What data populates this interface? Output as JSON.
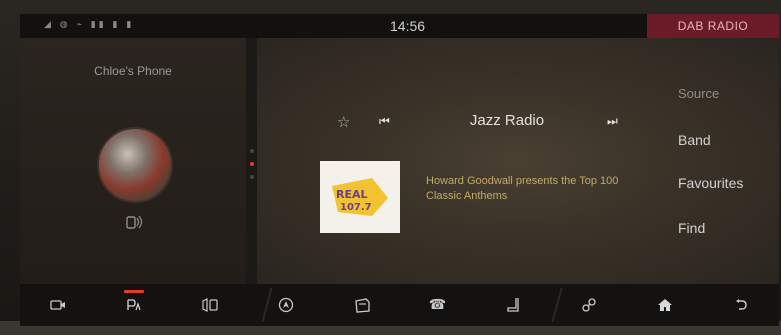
{
  "status_bar": {
    "indicators": "◢ ◍ ⌁ ▮▮ ▮ ▮",
    "time": "14:56",
    "active_tab": "DAB RADIO"
  },
  "phone": {
    "name": "Chloe's Phone"
  },
  "player": {
    "station": "Jazz Radio",
    "now_playing": "Howard Goodwall presents the Top 100 Classic Anthems",
    "album_art_text": "REAL 107.7"
  },
  "side_menu": {
    "items": [
      "Source",
      "Band",
      "Favourites",
      "Find"
    ]
  },
  "bottom_nav": {
    "items": [
      "camera-icon",
      "media-icon",
      "phone-projection-icon",
      "navigation-icon",
      "vehicle-icon",
      "phone-icon",
      "seat-icon",
      "connect-icon",
      "home-icon",
      "back-icon"
    ]
  },
  "colors": {
    "accent": "#e33a2e",
    "tab_bg": "#6b1c28",
    "text_highlight": "#c4a86a"
  }
}
